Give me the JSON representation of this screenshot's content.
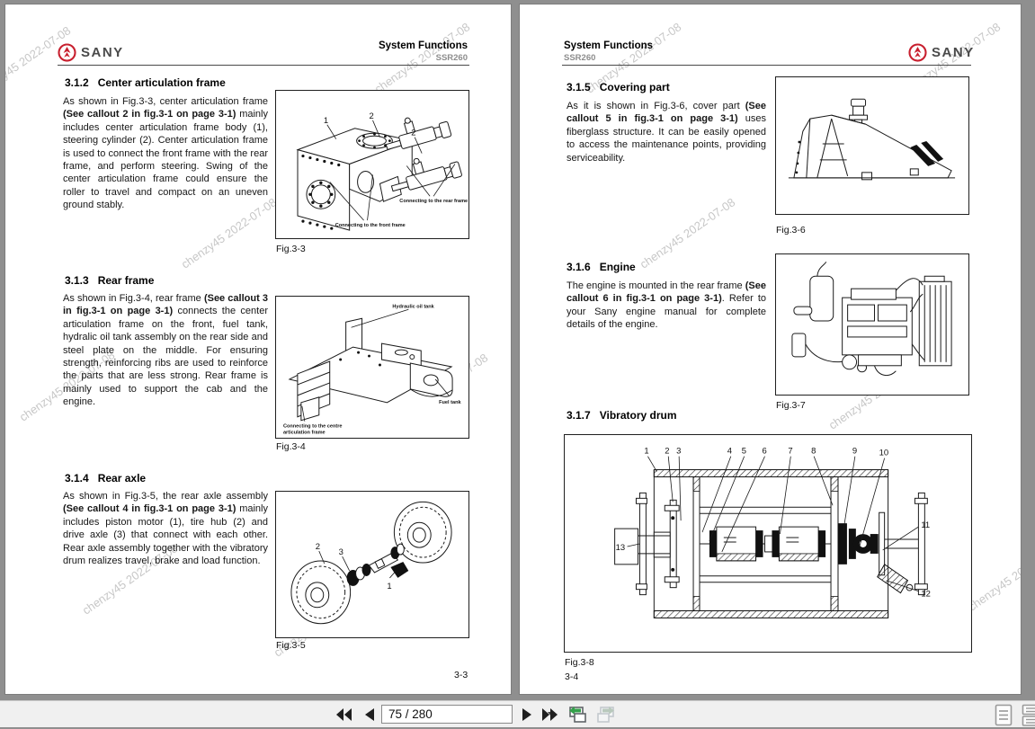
{
  "watermark": {
    "text": "chenzy45 2022-07-08"
  },
  "brand": {
    "name": "SANY",
    "red": "#c8202f"
  },
  "pages": {
    "left": {
      "header": {
        "title": "System Functions",
        "model": "SSR260"
      },
      "page_number": "3-3",
      "sections": [
        {
          "num": "3.1.2",
          "title": "Center articulation frame",
          "paragraph": [
            {
              "t": "As shown in Fig.3-3, center articulation frame ",
              "b": false
            },
            {
              "t": "(See callout 2 in fig.3-1 on page 3-1)",
              "b": true
            },
            {
              "t": " mainly includes center articulation frame body (1), steering cylinder (2). Center articulation frame is used to connect the front frame with the rear frame, and perform steering. Swing of the center articulation frame could ensure the roller to travel and compact on an uneven ground stably.",
              "b": false
            }
          ]
        },
        {
          "num": "3.1.3",
          "title": "Rear frame",
          "paragraph": [
            {
              "t": "As shown in Fig.3-4, rear frame ",
              "b": false
            },
            {
              "t": "(See callout 3 in fig.3-1 on page 3-1)",
              "b": true
            },
            {
              "t": "  connects the center articulation frame on the front, fuel tank, hydralic oil tank assembly on the rear side and steel plate on the middle. For ensuring strength, reinforcing ribs are used to reinforce the parts that are less strong. Rear frame is mainly used to support the cab and the engine.",
              "b": false
            }
          ]
        },
        {
          "num": "3.1.4",
          "title": "Rear axle",
          "paragraph": [
            {
              "t": "As shown in Fig.3-5, the rear axle assembly ",
              "b": false
            },
            {
              "t": "(See callout 4 in fig.3-1 on page 3-1)",
              "b": true
            },
            {
              "t": " mainly includes piston motor (1), tire hub (2) and drive axle (3) that connect with each other. Rear axle assembly together with the vibratory drum realizes travel, brake and load function.",
              "b": false
            }
          ]
        }
      ]
    },
    "right": {
      "header": {
        "title": "System Functions",
        "model": "SSR260"
      },
      "page_number": "3-4",
      "sections": [
        {
          "num": "3.1.5",
          "title": "Covering part",
          "paragraph": [
            {
              "t": "As it is shown in Fig.3-6, cover part ",
              "b": false
            },
            {
              "t": "(See callout 5 in fig.3-1 on page 3-1)",
              "b": true
            },
            {
              "t": " uses fiberglass structure. It can be easily opened to access the maintenance points, providing serviceability.",
              "b": false
            }
          ]
        },
        {
          "num": "3.1.6",
          "title": "Engine",
          "paragraph": [
            {
              "t": "The engine is mounted in the rear frame ",
              "b": false
            },
            {
              "t": "(See callout 6 in fig.3-1 on page 3-1)",
              "b": true
            },
            {
              "t": ". Refer to your Sany engine manual for complete details of the engine.",
              "b": false
            }
          ]
        },
        {
          "num": "3.1.7",
          "title": "Vibratory drum",
          "paragraph": []
        }
      ]
    }
  },
  "figures": {
    "fig33": {
      "caption": "Fig.3-3",
      "callout_1": "1",
      "callout_2a": "2",
      "callout_2b": "2",
      "label_rear": "Connecting to the rear frame",
      "label_front": "Connecting to the front frame"
    },
    "fig34": {
      "caption": "Fig.3-4",
      "label_hydraulic": "Hydraulic oil tank",
      "label_fuel": "Fuel tank",
      "label_connecting_1": "Connecting to the centre",
      "label_connecting_2": "articulation frame"
    },
    "fig35": {
      "caption": "Fig.3-5",
      "callout_1": "1",
      "callout_2": "2",
      "callout_3": "3"
    },
    "fig36": {
      "caption": "Fig.3-6"
    },
    "fig37": {
      "caption": "Fig.3-7"
    },
    "fig38": {
      "caption": "Fig.3-8",
      "callouts": [
        "1",
        "2",
        "3",
        "4",
        "5",
        "6",
        "7",
        "8",
        "9",
        "10",
        "11",
        "12",
        "13"
      ]
    }
  },
  "toolbar": {
    "page_input": "75 / 280",
    "icons": {
      "first": "first-page-icon",
      "prev": "previous-page-icon",
      "next": "next-page-icon",
      "last": "last-page-icon",
      "prev_view": "previous-view-icon",
      "next_view": "next-view-icon",
      "single_page": "single-page-layout-icon",
      "facing_page": "continuous-page-layout-icon"
    }
  }
}
